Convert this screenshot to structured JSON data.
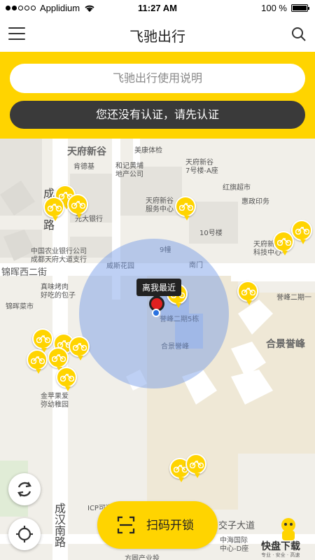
{
  "status_bar": {
    "carrier": "Applidium",
    "time": "11:27 AM",
    "battery": "100 %",
    "battery_level": 1.0
  },
  "header": {
    "title": "飞驰出行",
    "menu_icon": "hamburger-menu-icon",
    "search_icon": "search-icon"
  },
  "search": {
    "placeholder": "飞驰出行使用说明"
  },
  "verify_banner": {
    "label": "您还没有认证，请先认证"
  },
  "map": {
    "labels": {
      "tianfu_xingu": "天府新谷",
      "meikang": "美康体检",
      "kfc": "肯德基",
      "heji": "和记黄埔",
      "heji2": "地产公司",
      "tianfu_block": "天府新谷",
      "tianfu_block2": "7号楼-A座",
      "hongqi": "红旗超市",
      "huizheng": "惠政印务",
      "tianfu_service": "天府新谷",
      "tianfu_service2": "服务中心",
      "yuanda": "元大银行",
      "bldg10": "10号楼",
      "abc": "中国农业银行公司",
      "abc2": "成都天府大道支行",
      "tianfu_tech": "天府新谷",
      "tianfu_tech2": "科技中心",
      "weisi": "威斯花园",
      "nanmen": "南门",
      "bldg9": "9幢",
      "jinhui_w2": "锦晖西二街",
      "zhenwei": "真味烤肉",
      "zhenwei2": "好吃的包子",
      "jinhui_market": "锦晖菜市",
      "yufeng_road": "誉峰二期一",
      "yufeng_bldg5": "誉峰二期5栋",
      "hejing_yufeng": "合景誉峰",
      "hejing_big": "合景誉峰",
      "jinhua": "金苹果爱",
      "jinhua2": "弥幼稚园",
      "chengdu_road": "成汉南路",
      "icp": "ICP可通",
      "jiaozi": "交子大道",
      "zhonghai": "中海国际",
      "zhonghai2": "中心-D座",
      "fangyuan": "方圆产业投",
      "cheng": "成",
      "lu": "路"
    },
    "tooltip": "离我最近",
    "refresh_icon": "refresh-icon",
    "locate_icon": "locate-icon"
  },
  "scan_button": {
    "label": "扫码开锁",
    "icon": "scan-icon"
  },
  "watermark": {
    "text": "快盘下载",
    "sub": "专业 · 安全 · 高速"
  },
  "colors": {
    "accent": "#ffd400",
    "dark": "#3a3a3a"
  }
}
